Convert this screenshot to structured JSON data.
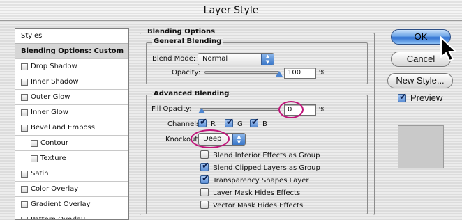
{
  "window": {
    "title": "Layer Style"
  },
  "styles_panel": {
    "header": "Styles",
    "items": [
      {
        "label": "Blending Options: Custom",
        "selected": true,
        "checkbox": false,
        "indent": false
      },
      {
        "label": "Drop Shadow",
        "checkbox": true,
        "indent": false
      },
      {
        "label": "Inner Shadow",
        "checkbox": true,
        "indent": false
      },
      {
        "label": "Outer Glow",
        "checkbox": true,
        "indent": false
      },
      {
        "label": "Inner Glow",
        "checkbox": true,
        "indent": false
      },
      {
        "label": "Bevel and Emboss",
        "checkbox": true,
        "indent": false
      },
      {
        "label": "Contour",
        "checkbox": true,
        "indent": true
      },
      {
        "label": "Texture",
        "checkbox": true,
        "indent": true
      },
      {
        "label": "Satin",
        "checkbox": true,
        "indent": false
      },
      {
        "label": "Color Overlay",
        "checkbox": true,
        "indent": false
      },
      {
        "label": "Gradient Overlay",
        "checkbox": true,
        "indent": false
      },
      {
        "label": "Pattern Overlay",
        "checkbox": true,
        "indent": false
      }
    ]
  },
  "blending_options": {
    "title": "Blending Options",
    "general": {
      "title": "General Blending",
      "blend_mode_label": "Blend Mode:",
      "blend_mode_value": "Normal",
      "opacity_label": "Opacity:",
      "opacity_value": "100",
      "opacity_unit": "%"
    },
    "advanced": {
      "title": "Advanced Blending",
      "fill_opacity_label": "Fill Opacity:",
      "fill_opacity_value": "0",
      "fill_opacity_unit": "%",
      "channels_label": "Channels:",
      "channels": [
        {
          "label": "R",
          "checked": true
        },
        {
          "label": "G",
          "checked": true
        },
        {
          "label": "B",
          "checked": true
        }
      ],
      "knockout_label": "Knockout:",
      "knockout_value": "Deep",
      "options": [
        {
          "label": "Blend Interior Effects as Group",
          "checked": false
        },
        {
          "label": "Blend Clipped Layers as Group",
          "checked": true
        },
        {
          "label": "Transparency Shapes Layer",
          "checked": true
        },
        {
          "label": "Layer Mask Hides Effects",
          "checked": false
        },
        {
          "label": "Vector Mask Hides Effects",
          "checked": false
        }
      ]
    }
  },
  "buttons": {
    "ok": "OK",
    "cancel": "Cancel",
    "new_style": "New Style...",
    "preview_label": "Preview",
    "preview_checked": true
  },
  "colors": {
    "highlight_oval": "#c0157a",
    "aqua_blue": "#3a77c8"
  }
}
